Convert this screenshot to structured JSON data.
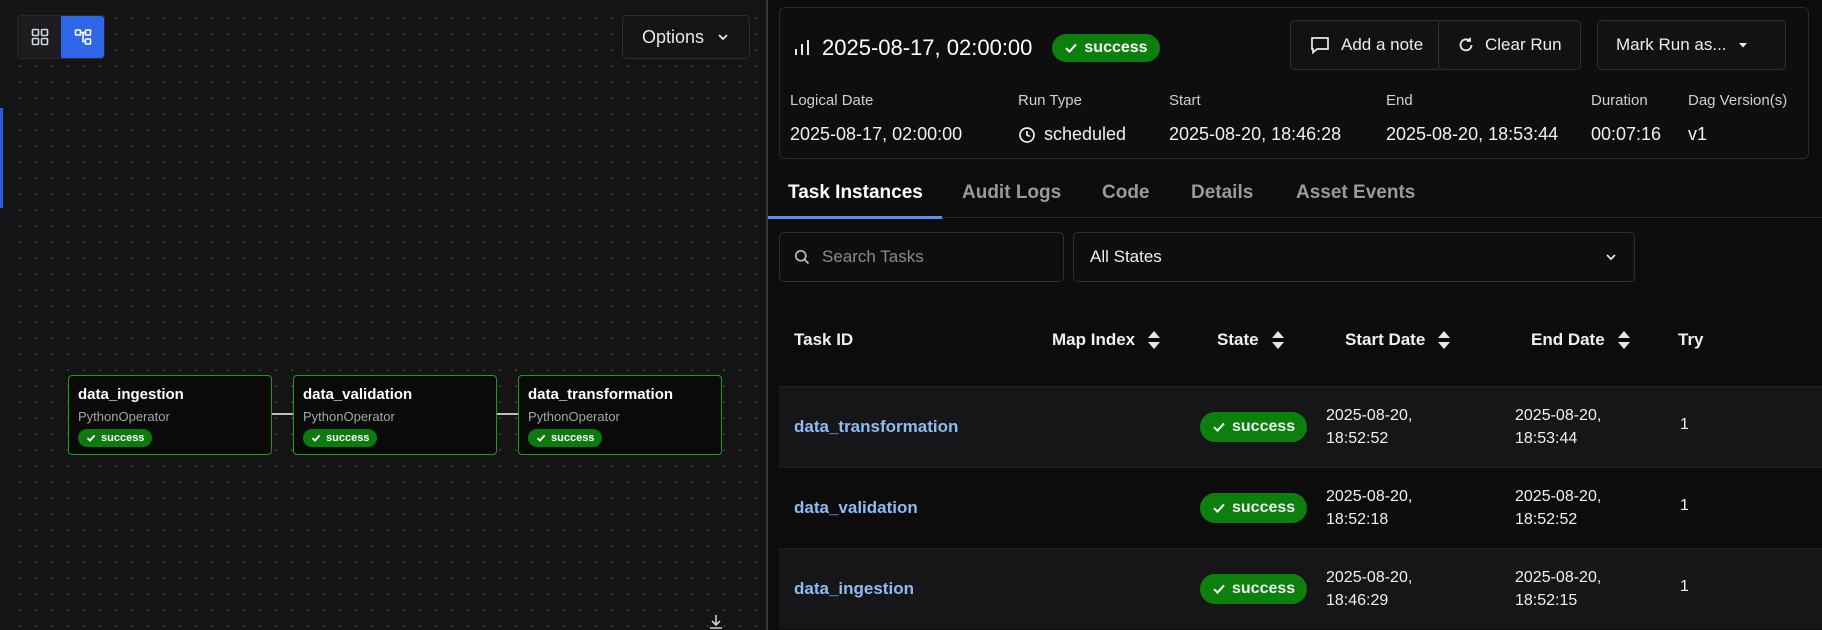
{
  "graph": {
    "options_label": "Options",
    "nodes": [
      {
        "name": "data_ingestion",
        "operator": "PythonOperator",
        "state": "success"
      },
      {
        "name": "data_validation",
        "operator": "PythonOperator",
        "state": "success"
      },
      {
        "name": "data_transformation",
        "operator": "PythonOperator",
        "state": "success"
      }
    ]
  },
  "run": {
    "title": "2025-08-17, 02:00:00",
    "state": "success",
    "buttons": {
      "add_note": "Add a note",
      "clear_run": "Clear Run",
      "mark_run": "Mark Run as..."
    },
    "meta": {
      "logical_date_label": "Logical Date",
      "logical_date": "2025-08-17, 02:00:00",
      "run_type_label": "Run Type",
      "run_type": "scheduled",
      "start_label": "Start",
      "start": "2025-08-20, 18:46:28",
      "end_label": "End",
      "end": "2025-08-20, 18:53:44",
      "duration_label": "Duration",
      "duration": "00:07:16",
      "dag_version_label": "Dag Version(s)",
      "dag_version": "v1"
    }
  },
  "tabs": [
    "Task Instances",
    "Audit Logs",
    "Code",
    "Details",
    "Asset Events"
  ],
  "filters": {
    "search_placeholder": "Search Tasks",
    "state_select": "All States"
  },
  "table": {
    "columns": [
      "Task ID",
      "Map Index",
      "State",
      "Start Date",
      "End Date",
      "Try"
    ],
    "rows": [
      {
        "task_id": "data_transformation",
        "state": "success",
        "start_date": "2025-08-20,",
        "start_time": "18:52:52",
        "end_date": "2025-08-20,",
        "end_time": "18:53:44",
        "try": "1"
      },
      {
        "task_id": "data_validation",
        "state": "success",
        "start_date": "2025-08-20,",
        "start_time": "18:52:18",
        "end_date": "2025-08-20,",
        "end_time": "18:52:52",
        "try": "1"
      },
      {
        "task_id": "data_ingestion",
        "state": "success",
        "start_date": "2025-08-20,",
        "start_time": "18:46:29",
        "end_date": "2025-08-20,",
        "end_time": "18:52:15",
        "try": "1"
      }
    ]
  },
  "colors": {
    "success": "#0d7f0d",
    "accent": "#2f66e8",
    "link": "#8cbcf5"
  }
}
